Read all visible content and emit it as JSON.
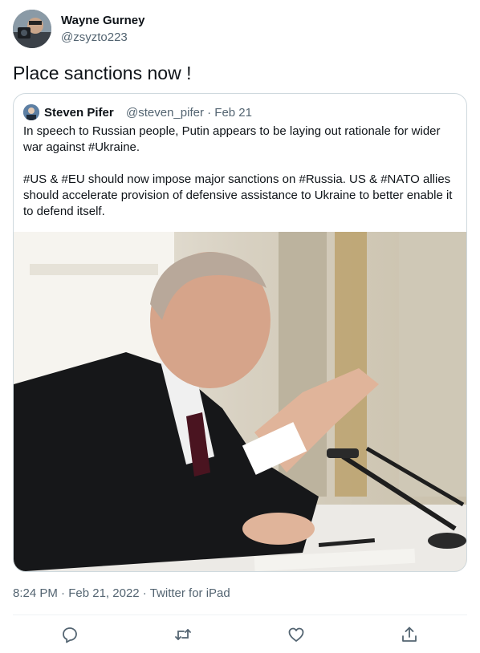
{
  "tweet": {
    "author": {
      "name": "Wayne Gurney",
      "handle": "@zsyzto223"
    },
    "text": "Place sanctions now !",
    "timestamp": "8:24 PM",
    "date": "Feb 21, 2022",
    "source": "Twitter for iPad",
    "separator": " · "
  },
  "quote": {
    "author": {
      "name": "Steven Pifer",
      "handle": "@steven_pifer",
      "date": "Feb 21"
    },
    "paragraphs": [
      "In speech to Russian people, Putin appears to be laying out rationale for wider war against #Ukraine.",
      "#US & #EU should now impose major sanctions on #Russia. US & #NATO allies should accelerate provision of defensive assistance to Ukraine to better enable it to defend itself."
    ]
  },
  "actions": {
    "icons": [
      "reply-icon",
      "retweet-icon",
      "like-icon",
      "share-icon"
    ],
    "icon_color": "#536471"
  },
  "colors": {
    "text": "#0f1419",
    "secondary": "#536471",
    "border": "#cfd9de"
  }
}
